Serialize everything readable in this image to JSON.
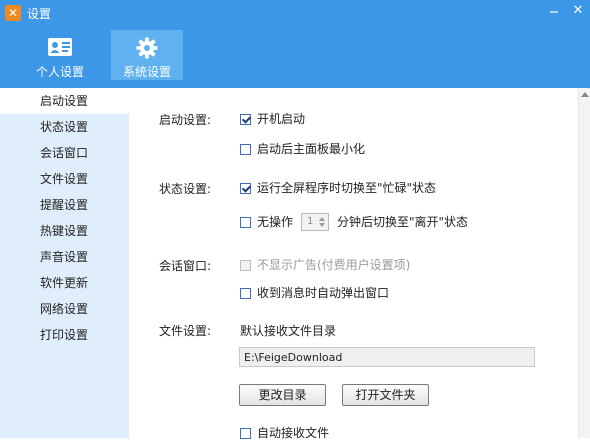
{
  "window": {
    "title": "设置",
    "close_glyph": "✕"
  },
  "tabs": [
    {
      "label": "个人设置",
      "icon": "user-card-icon"
    },
    {
      "label": "系统设置",
      "icon": "gear-icon",
      "active": true
    }
  ],
  "sidebar": {
    "items": [
      {
        "label": "启动设置",
        "active": true
      },
      {
        "label": "状态设置"
      },
      {
        "label": "会话窗口"
      },
      {
        "label": "文件设置"
      },
      {
        "label": "提醒设置"
      },
      {
        "label": "热键设置"
      },
      {
        "label": "声音设置"
      },
      {
        "label": "软件更新"
      },
      {
        "label": "网络设置"
      },
      {
        "label": "打印设置"
      }
    ]
  },
  "sections": {
    "startup": {
      "label": "启动设置:",
      "auto_start": {
        "label": "开机启动",
        "checked": true
      },
      "minimize_after_start": {
        "label": "启动后主面板最小化",
        "checked": false
      }
    },
    "status": {
      "label": "状态设置:",
      "fullscreen_busy": {
        "label": "运行全屏程序时切换至\"忙碌\"状态",
        "checked": true
      },
      "idle_away": {
        "prefix": "无操作",
        "value": "1",
        "suffix": "分钟后切换至\"离开\"状态",
        "checked": false
      }
    },
    "chat": {
      "label": "会话窗口:",
      "hide_ads": {
        "label": "不显示广告(付费用户设置项)",
        "checked": false,
        "disabled": true
      },
      "popup_on_message": {
        "label": "收到消息时自动弹出窗口",
        "checked": false
      }
    },
    "file": {
      "label": "文件设置:",
      "dir_label": "默认接收文件目录",
      "dir_value": "E:\\FeigeDownload",
      "change_dir_button": "更改目录",
      "open_folder_button": "打开文件夹",
      "auto_receive": {
        "label": "自动接收文件",
        "checked": false
      }
    }
  },
  "colors": {
    "header": "#3c98e6",
    "tab_active": "#5fb1f0",
    "sidebar": "#dfeefa",
    "logo": "#f08a1c"
  }
}
